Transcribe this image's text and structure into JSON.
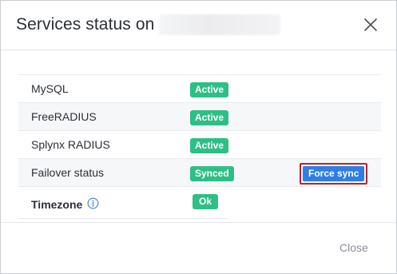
{
  "modal": {
    "title": "Services status on",
    "close_label": "Close"
  },
  "services": [
    {
      "name": "MySQL",
      "status": "Active"
    },
    {
      "name": "FreeRADIUS",
      "status": "Active"
    },
    {
      "name": "Splynx RADIUS",
      "status": "Active"
    },
    {
      "name": "Failover status",
      "status": "Synced",
      "action": "Force sync"
    }
  ],
  "timezone": {
    "label": "Timezone",
    "status": "Ok"
  },
  "colors": {
    "status_green": "#2dbf84",
    "action_blue": "#2f7ee6",
    "highlight_red": "#b3262c",
    "info_blue": "#3d7fe0"
  },
  "icons": {
    "close": "close-icon",
    "info": "info-icon"
  }
}
